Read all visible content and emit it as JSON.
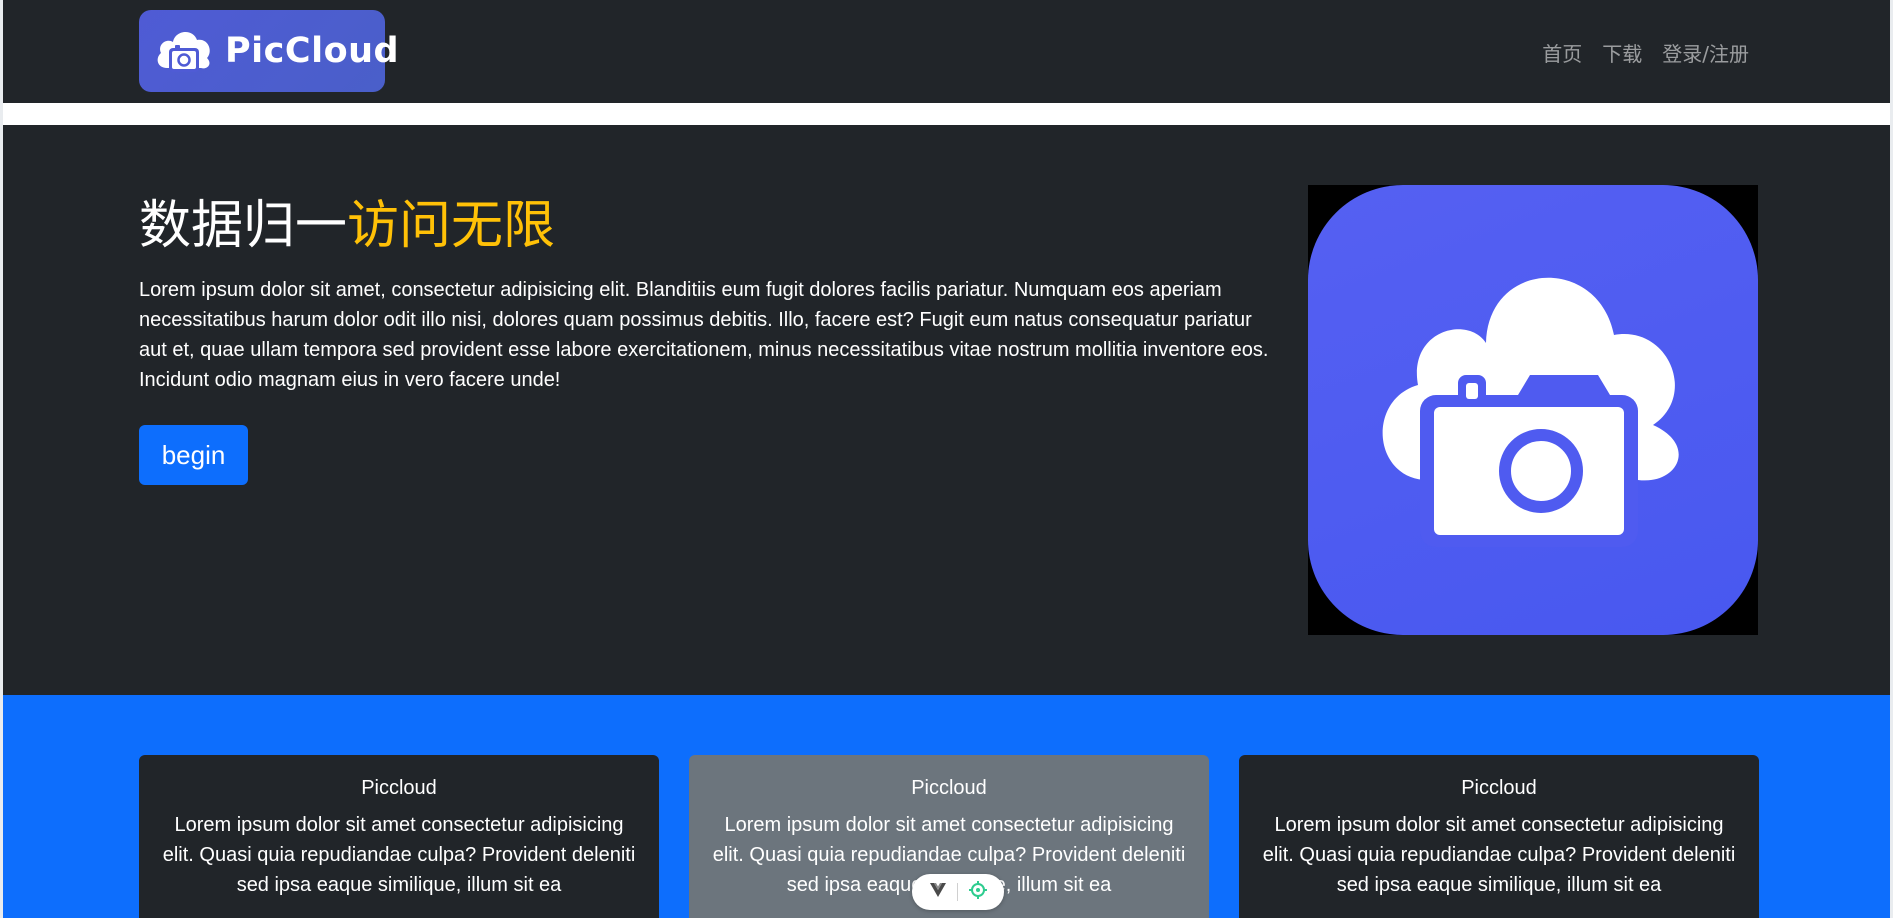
{
  "navbar": {
    "logo_text": "PicCloud",
    "links": [
      {
        "label": "首页"
      },
      {
        "label": "下载"
      },
      {
        "label": "登录/注册"
      }
    ]
  },
  "hero": {
    "title_main": "数据归一",
    "title_accent": "访问无限",
    "text": "Lorem ipsum dolor sit amet, consectetur adipisicing elit. Blanditiis eum fugit dolores facilis pariatur. Numquam eos aperiam necessitatibus harum dolor odit illo nisi, dolores quam possimus debitis. Illo, facere est? Fugit eum natus consequatur pariatur aut et, quae ullam tempora sed provident esse labore exercitationem, minus necessitatibus vitae nostrum mollitia inventore eos. Incidunt odio magnam eius in vero facere unde!",
    "button_label": "begin",
    "image_icon": "cloud-camera-icon"
  },
  "features": {
    "cards": [
      {
        "title": "Piccloud",
        "text": "Lorem ipsum dolor sit amet consectetur adipisicing elit. Quasi quia repudiandae culpa? Provident deleniti sed ipsa eaque similique, illum sit ea"
      },
      {
        "title": "Piccloud",
        "text": "Lorem ipsum dolor sit amet consectetur adipisicing elit. Quasi quia repudiandae culpa? Provident deleniti sed ipsa eaque similique, illum sit ea"
      },
      {
        "title": "Piccloud",
        "text": "Lorem ipsum dolor sit amet consectetur adipisicing elit. Quasi quia repudiandae culpa? Provident deleniti sed ipsa eaque similique, illum sit ea"
      }
    ]
  },
  "floating_toolbar": {
    "icons": [
      "vue-devtools-icon",
      "inspect-target-icon"
    ]
  },
  "colors": {
    "dark": "#212529",
    "primary": "#0d6efd",
    "accent": "#ffc107",
    "secondary": "#6c757d",
    "brand": "#4f5bd5"
  }
}
